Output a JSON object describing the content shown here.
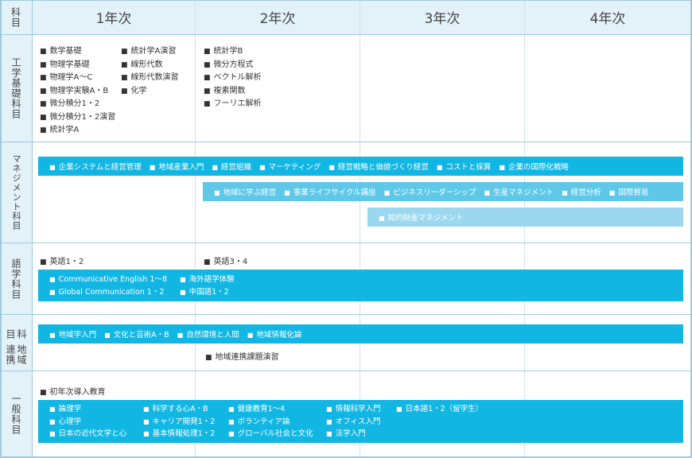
{
  "header": {
    "corner": "科目",
    "years": [
      "1年次",
      "2年次",
      "3年次",
      "4年次"
    ]
  },
  "rows": {
    "engineering": {
      "label": "工学基礎科目",
      "year1_col1": [
        "数学基礎",
        "物理学基礎",
        "物理学A～C",
        "物理学実験A・B",
        "微分積分1・2",
        "微分積分1・2演習",
        "統計学A"
      ],
      "year1_col2": [
        "統計学A演習",
        "線形代数",
        "線形代数演習",
        "化学"
      ],
      "year2": [
        "統計学B",
        "微分方程式",
        "ベクトル解析",
        "複素関数",
        "フーリエ解析"
      ]
    },
    "management": {
      "label": "マネジメント科目",
      "bar1": [
        "企業システムと経営管理",
        "地域産業入門",
        "経営組織",
        "マーケティング",
        "経営戦略と価値づくり経営",
        "コストと採算",
        "企業の国際化戦略"
      ],
      "bar2": [
        "地域に学ぶ経営",
        "事業ライフサイクル講座",
        "ビジネスリーダーシップ",
        "生産マネジメント",
        "経営分析",
        "国際貿易"
      ],
      "bar3": [
        "知的財産マネジメント"
      ]
    },
    "language": {
      "label": "語学科目",
      "year1": "英語1・2",
      "year2": "英語3・4",
      "bar_col1": [
        "Communicative English 1～8",
        "Global Communication 1・2"
      ],
      "bar_col2": [
        "海外語学体験",
        "中国語1・2"
      ]
    },
    "regional": {
      "label_line1": "地域連携",
      "label_line2": "科目",
      "bar": [
        "地域学入門",
        "文化と芸術A・B",
        "自然環境と人間",
        "地域情報化論"
      ],
      "year2": "地域連携課題演習"
    },
    "general": {
      "label": "一般科目",
      "intro": "初年次導入教育",
      "col1": [
        "論理学",
        "心理学",
        "日本の近代文学と心"
      ],
      "col2": [
        "科学する心A・B",
        "キャリア開発1・2",
        "基本情報処理1・2"
      ],
      "col3": [
        "健康教育1～4",
        "ボランティア論",
        "グローバル社会と文化"
      ],
      "col4": [
        "情報科学入門",
        "オフィス入門",
        "法学入門"
      ],
      "col5": [
        "日本語1・2（留学生）"
      ]
    }
  },
  "colors": {
    "bar_primary": "#12b6e3",
    "bar_secondary": "#5fc8e9",
    "bar_tertiary": "#9bd8ef",
    "header_bg": "#e3f1f8",
    "grid_line": "#9fc9dd"
  }
}
